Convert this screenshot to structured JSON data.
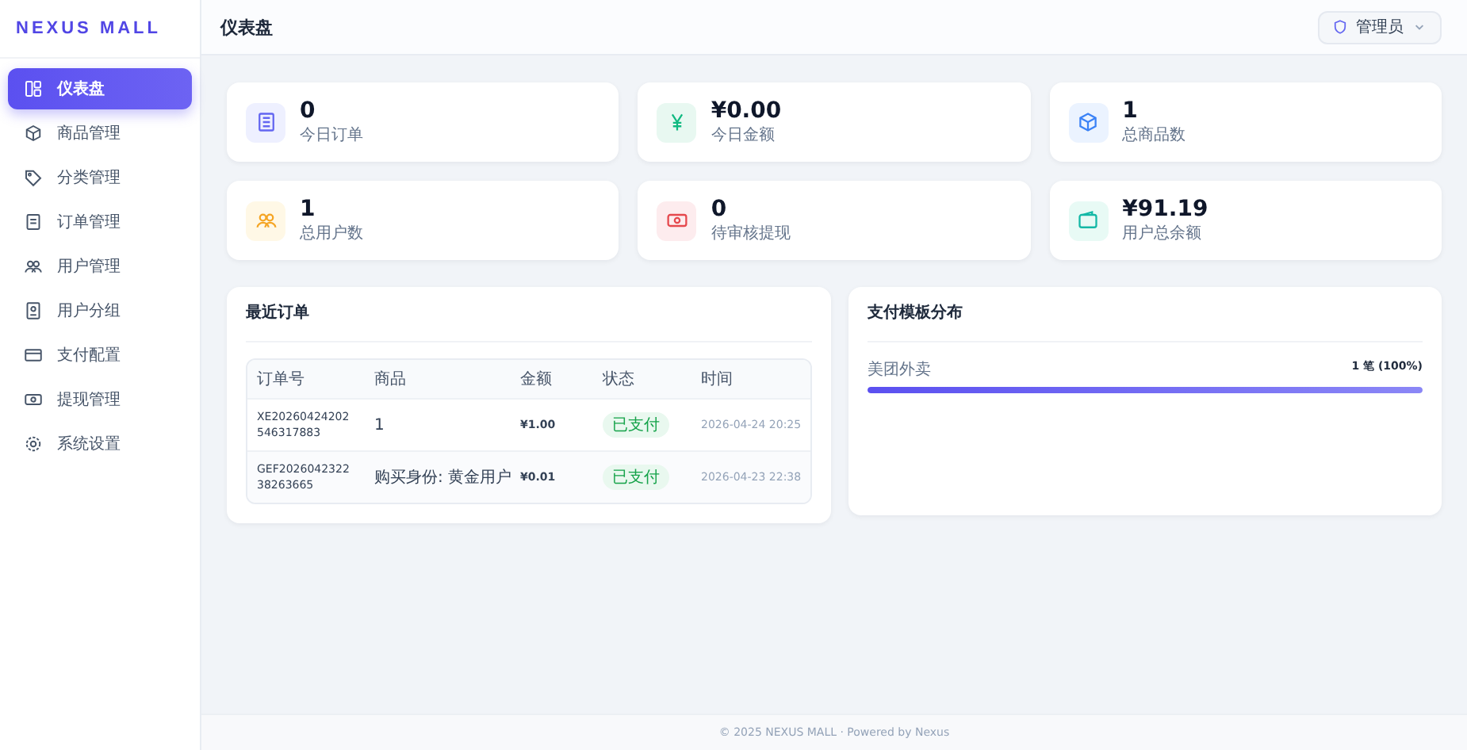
{
  "sidebar": {
    "logo": "NEXUS MALL",
    "items": [
      {
        "label": "仪表盘",
        "selected": true
      },
      {
        "label": "商品管理",
        "selected": false
      },
      {
        "label": "分类管理",
        "selected": false
      },
      {
        "label": "订单管理",
        "selected": false
      },
      {
        "label": "用户管理",
        "selected": false
      },
      {
        "label": "用户分组",
        "selected": false
      },
      {
        "label": "支付配置",
        "selected": false
      },
      {
        "label": "提现管理",
        "selected": false
      },
      {
        "label": "系统设置",
        "selected": false
      }
    ]
  },
  "header": {
    "title": "仪表盘",
    "user_menu": "管理员"
  },
  "stats": [
    {
      "value": "0",
      "label": "今日订单"
    },
    {
      "value": "¥0.00",
      "label": "今日金额"
    },
    {
      "value": "1",
      "label": "总商品数"
    },
    {
      "value": "1",
      "label": "总用户数"
    },
    {
      "value": "0",
      "label": "待审核提现"
    },
    {
      "value": "¥91.19",
      "label": "用户总余额"
    }
  ],
  "recent_orders": {
    "title": "最近订单",
    "columns": [
      "订单号",
      "商品",
      "金额",
      "状态",
      "时间"
    ],
    "rows": [
      {
        "order_no": "XE20260424202546317883",
        "product": "1",
        "amount": "¥1.00",
        "status": "已支付",
        "time": "2026-04-24 20:25"
      },
      {
        "order_no": "GEF202604232238263665",
        "product": "购买身份: 黄金用户",
        "amount": "¥0.01",
        "status": "已支付",
        "time": "2026-04-23 22:38"
      }
    ]
  },
  "payment_distribution": {
    "title": "支付模板分布",
    "items": [
      {
        "label": "美团外卖",
        "reading": "1 笔 (100%)",
        "level": 1
      }
    ]
  },
  "footer": "© 2025 NEXUS MALL · Powered by Nexus"
}
